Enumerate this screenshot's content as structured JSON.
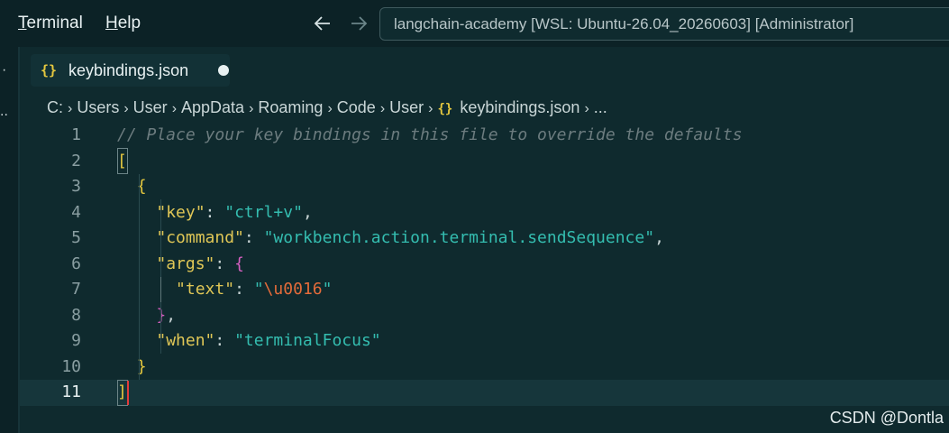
{
  "menu": {
    "terminal_underline": "T",
    "terminal_rest": "erminal",
    "help_underline": "H",
    "help_rest": "elp"
  },
  "nav": {
    "back_icon": "arrow-left-icon",
    "forward_icon": "arrow-right-icon"
  },
  "command_center": {
    "text": "langchain-academy [WSL: Ubuntu-26.04_20260603] [Administrator]"
  },
  "tab": {
    "icon": "{}",
    "label": "keybindings.json",
    "dirty": true
  },
  "breadcrumb": {
    "items": [
      "C:",
      "Users",
      "User",
      "AppData",
      "Roaming",
      "Code",
      "User"
    ],
    "file_icon": "{}",
    "file": "keybindings.json",
    "more": "..."
  },
  "editor": {
    "current_line": 11,
    "lines": [
      {
        "n": "1",
        "tokens": [
          [
            "comment",
            "// Place your key bindings in this file to override the defaults"
          ]
        ]
      },
      {
        "n": "2",
        "tokens": [
          [
            "bracket-yellow",
            "["
          ]
        ]
      },
      {
        "n": "3",
        "tokens": [
          [
            "punct",
            "  "
          ],
          [
            "bracket-yellow",
            "{"
          ]
        ]
      },
      {
        "n": "4",
        "tokens": [
          [
            "punct",
            "    "
          ],
          [
            "key",
            "\"key\""
          ],
          [
            "punct",
            ": "
          ],
          [
            "str",
            "\"ctrl+v\""
          ],
          [
            "punct",
            ","
          ]
        ]
      },
      {
        "n": "5",
        "tokens": [
          [
            "punct",
            "    "
          ],
          [
            "key",
            "\"command\""
          ],
          [
            "punct",
            ": "
          ],
          [
            "str",
            "\"workbench.action.terminal.sendSequence\""
          ],
          [
            "punct",
            ","
          ]
        ]
      },
      {
        "n": "6",
        "tokens": [
          [
            "punct",
            "    "
          ],
          [
            "key",
            "\"args\""
          ],
          [
            "punct",
            ": "
          ],
          [
            "bracket-pink",
            "{"
          ]
        ]
      },
      {
        "n": "7",
        "tokens": [
          [
            "punct",
            "      "
          ],
          [
            "key",
            "\"text\""
          ],
          [
            "punct",
            ": "
          ],
          [
            "str",
            "\""
          ],
          [
            "esc",
            "\\u0016"
          ],
          [
            "str",
            "\""
          ]
        ]
      },
      {
        "n": "8",
        "tokens": [
          [
            "punct",
            "    "
          ],
          [
            "bracket-pink",
            "}"
          ],
          [
            "punct",
            ","
          ]
        ]
      },
      {
        "n": "9",
        "tokens": [
          [
            "punct",
            "    "
          ],
          [
            "key",
            "\"when\""
          ],
          [
            "punct",
            ": "
          ],
          [
            "str",
            "\"terminalFocus\""
          ]
        ]
      },
      {
        "n": "10",
        "tokens": [
          [
            "punct",
            "  "
          ],
          [
            "bracket-yellow",
            "}"
          ]
        ]
      },
      {
        "n": "11",
        "tokens": [
          [
            "bracket-yellow",
            "]"
          ]
        ]
      }
    ]
  },
  "watermark": "CSDN @Dontla"
}
